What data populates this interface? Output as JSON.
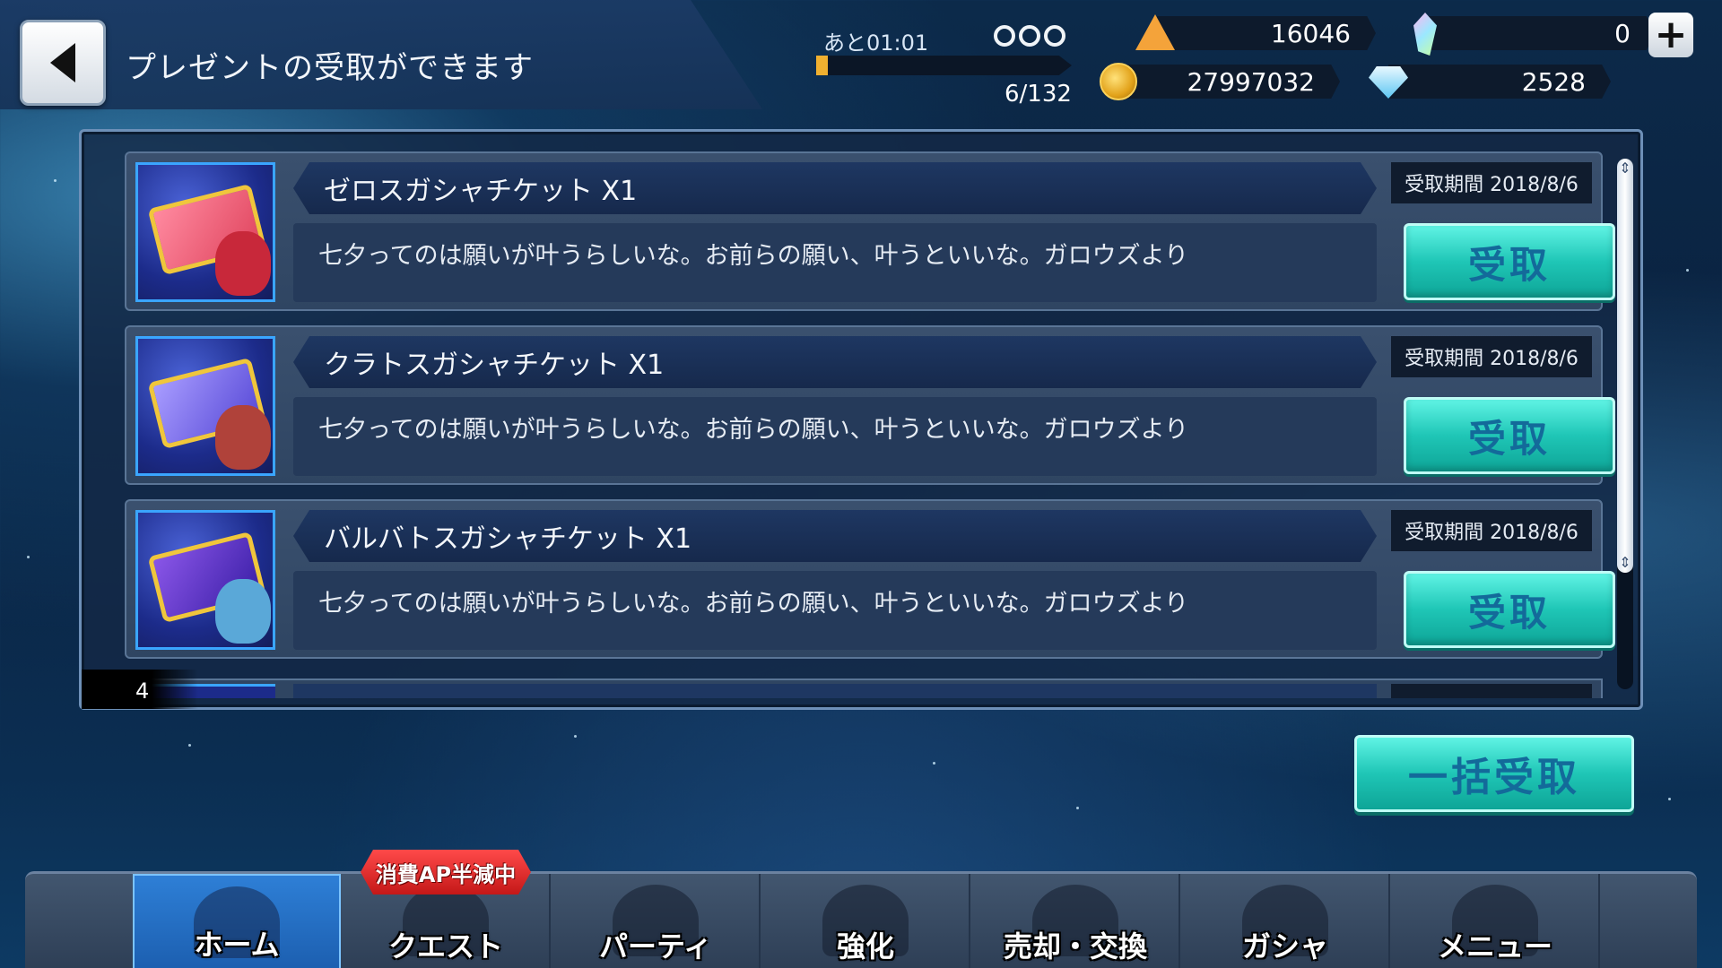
{
  "header": {
    "title": "プレゼントの受取ができます",
    "back_icon": "chevron-left-icon"
  },
  "ap": {
    "timer": "あと01:01",
    "count": "6/132",
    "progress": 0.045
  },
  "resources": {
    "stamina_crystal": "16046",
    "gold": "27997032",
    "paid_crystal": "0",
    "diamond": "2528"
  },
  "presents": [
    {
      "name": "ゼロスガシャチケット X1",
      "message": "七夕ってのは願いが叶うらしいな。お前らの願い、叶うといいな。ガロウズより",
      "deadline": "受取期間 2018/8/6",
      "button": "受取",
      "ticket_color": "#e0455e"
    },
    {
      "name": "クラトスガシャチケット X1",
      "message": "七夕ってのは願いが叶うらしいな。お前らの願い、叶うといいな。ガロウズより",
      "deadline": "受取期間 2018/8/6",
      "button": "受取",
      "ticket_color": "#5648d6"
    },
    {
      "name": "バルバトスガシャチケット X1",
      "message": "七夕ってのは願いが叶うらしいな。お前らの願い、叶うといいな。ガロウズより",
      "deadline": "受取期間 2018/8/6",
      "button": "受取",
      "ticket_color": "#3a1ea6"
    }
  ],
  "list_index": "4",
  "receive_all_label": "一括受取",
  "ap_half_badge": "消費AP半減中",
  "nav": [
    {
      "label": "ホーム",
      "icon": "home-tower-icon",
      "active": true
    },
    {
      "label": "クエスト",
      "icon": "quest-plane-icon",
      "active": false
    },
    {
      "label": "パーティ",
      "icon": "party-icon",
      "active": false
    },
    {
      "label": "強化",
      "icon": "enhance-sword-icon",
      "active": false
    },
    {
      "label": "売却・交換",
      "icon": "trade-icon",
      "active": false
    },
    {
      "label": "ガシャ",
      "icon": "gacha-crystal-icon",
      "active": false
    },
    {
      "label": "メニュー",
      "icon": "menu-icon",
      "active": false
    }
  ],
  "colors": {
    "accent_teal": "#1fc6b6",
    "button_text": "#136a9a",
    "active_nav": "#2e7fd6"
  }
}
